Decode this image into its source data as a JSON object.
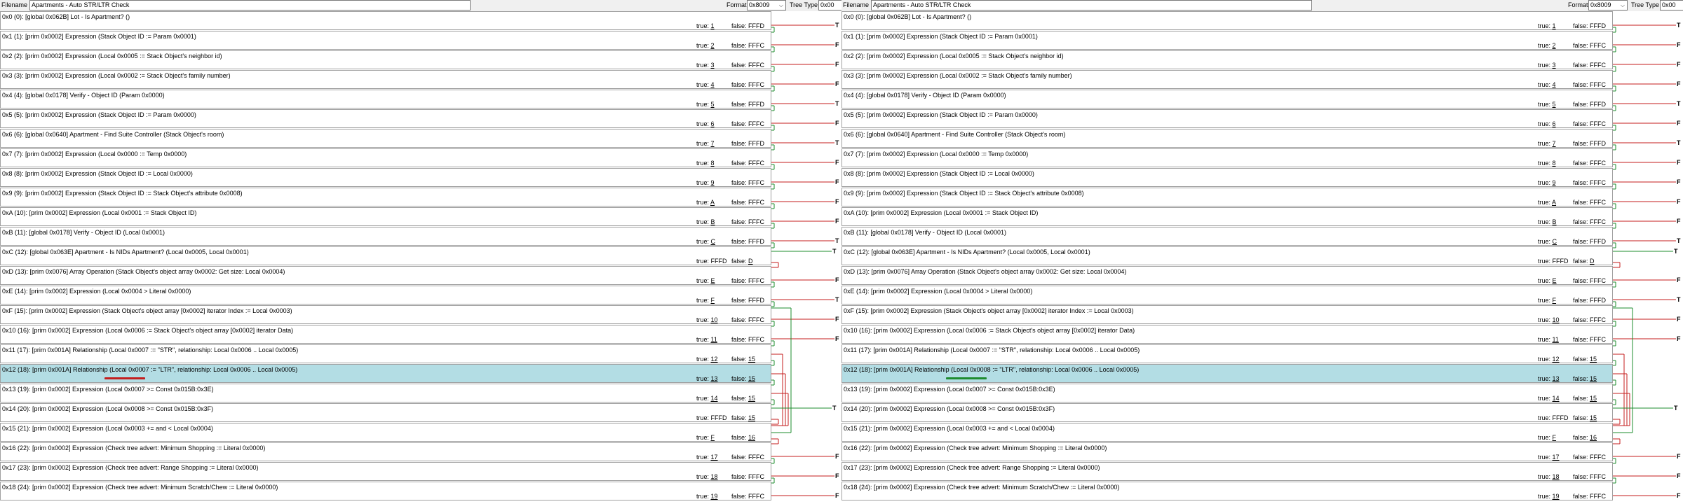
{
  "toolbar": {
    "filename_label": "Filename",
    "filename_value": "Apartments - Auto STR/LTR Check",
    "format_label": "Format",
    "format_value": "0x8009",
    "tree_type_label": "Tree Type",
    "tree_type_value": "0x00"
  },
  "colors": {
    "highlight_row": "#b3dde4",
    "wire_true": "#1e8c2e",
    "wire_false": "#c41e1e",
    "wire_exit": "#000000",
    "marker_left": "#c41e1e",
    "marker_right": "#1e8c2e"
  },
  "left_rows": [
    {
      "text": "0x0 (0): [global 0x062B] Lot - Is Apartment? ()",
      "true_prefix": "true: ",
      "true_target": "1",
      "false_prefix": "false: ",
      "false_target": "FFFD"
    },
    {
      "text": "0x1 (1): [prim 0x0002] Expression (Stack Object ID := Param 0x0001)",
      "true_prefix": "true: ",
      "true_target": "2",
      "false_prefix": "false: ",
      "false_target": "FFFC"
    },
    {
      "text": "0x2 (2): [prim 0x0002] Expression (Local 0x0005 := Stack Object's neighbor id)",
      "true_prefix": "true: ",
      "true_target": "3",
      "false_prefix": "false: ",
      "false_target": "FFFC"
    },
    {
      "text": "0x3 (3): [prim 0x0002] Expression (Local 0x0002 := Stack Object's family number)",
      "true_prefix": "true: ",
      "true_target": "4",
      "false_prefix": "false: ",
      "false_target": "FFFC"
    },
    {
      "text": "0x4 (4): [global 0x0178] Verify - Object ID (Param 0x0000)",
      "true_prefix": "true: ",
      "true_target": "5",
      "false_prefix": "false: ",
      "false_target": "FFFD"
    },
    {
      "text": "0x5 (5): [prim 0x0002] Expression (Stack Object ID := Param 0x0000)",
      "true_prefix": "true: ",
      "true_target": "6",
      "false_prefix": "false: ",
      "false_target": "FFFC"
    },
    {
      "text": "0x6 (6): [global 0x0640] Apartment - Find Suite Controller (Stack Object's room)",
      "true_prefix": "true: ",
      "true_target": "7",
      "false_prefix": "false: ",
      "false_target": "FFFD"
    },
    {
      "text": "0x7 (7): [prim 0x0002] Expression (Local 0x0000 := Temp 0x0000)",
      "true_prefix": "true: ",
      "true_target": "8",
      "false_prefix": "false: ",
      "false_target": "FFFC"
    },
    {
      "text": "0x8 (8): [prim 0x0002] Expression (Stack Object ID := Local 0x0000)",
      "true_prefix": "true: ",
      "true_target": "9",
      "false_prefix": "false: ",
      "false_target": "FFFC"
    },
    {
      "text": "0x9 (9): [prim 0x0002] Expression (Stack Object ID := Stack Object's attribute 0x0008)",
      "true_prefix": "true: ",
      "true_target": "A",
      "false_prefix": "false: ",
      "false_target": "FFFC"
    },
    {
      "text": "0xA (10): [prim 0x0002] Expression (Local 0x0001 := Stack Object ID)",
      "true_prefix": "true: ",
      "true_target": "B",
      "false_prefix": "false: ",
      "false_target": "FFFC"
    },
    {
      "text": "0xB (11): [global 0x0178] Verify - Object ID (Local 0x0001)",
      "true_prefix": "true: ",
      "true_target": "C",
      "false_prefix": "false: ",
      "false_target": "FFFD"
    },
    {
      "text": "0xC (12): [global 0x063E] Apartment - Is NIDs Apartment? (Local 0x0005, Local 0x0001)",
      "true_prefix": "true: ",
      "true_target": "FFFD",
      "false_prefix": "false: ",
      "false_target": "D"
    },
    {
      "text": "0xD (13): [prim 0x0076] Array Operation (Stack Object's object array 0x0002: Get size: Local 0x0004)",
      "true_prefix": "true: ",
      "true_target": "E",
      "false_prefix": "false: ",
      "false_target": "FFFC"
    },
    {
      "text": "0xE (14): [prim 0x0002] Expression (Local 0x0004 > Literal 0x0000)",
      "true_prefix": "true: ",
      "true_target": "F",
      "false_prefix": "false: ",
      "false_target": "FFFD"
    },
    {
      "text": "0xF (15): [prim 0x0002] Expression (Stack Object's object array [0x0002] iterator Index := Local 0x0003)",
      "true_prefix": "true: ",
      "true_target": "10",
      "false_prefix": "false: ",
      "false_target": "FFFC"
    },
    {
      "text": "0x10 (16): [prim 0x0002] Expression (Local 0x0006 := Stack Object's object array [0x0002] iterator Data)",
      "true_prefix": "true: ",
      "true_target": "11",
      "false_prefix": "false: ",
      "false_target": "FFFC"
    },
    {
      "text": "0x11 (17): [prim 0x001A] Relationship (Local 0x0007 := \"STR\", relationship: Local 0x0006 .. Local 0x0005)",
      "true_prefix": "true: ",
      "true_target": "12",
      "false_prefix": "false: ",
      "false_target": "15"
    },
    {
      "text": "0x12 (18): [prim 0x001A] Relationship (Local 0x0007 := \"LTR\", relationship: Local 0x0006 .. Local 0x0005)",
      "true_prefix": "true: ",
      "true_target": "13",
      "false_prefix": "false: ",
      "false_target": "15"
    },
    {
      "text": "0x13 (19): [prim 0x0002] Expression (Local 0x0007 >= Const 0x015B:0x3E)",
      "true_prefix": "true: ",
      "true_target": "14",
      "false_prefix": "false: ",
      "false_target": "15"
    },
    {
      "text": "0x14 (20): [prim 0x0002] Expression (Local 0x0008 >= Const 0x015B:0x3F)",
      "true_prefix": "true: ",
      "true_target": "FFFD",
      "false_prefix": "false: ",
      "false_target": "15"
    },
    {
      "text": "0x15 (21): [prim 0x0002] Expression (Local 0x0003 += and < Local 0x0004)",
      "true_prefix": "true: ",
      "true_target": "F",
      "false_prefix": "false: ",
      "false_target": "16"
    },
    {
      "text": "0x16 (22): [prim 0x0002] Expression (Check tree advert: Minimum Shopping := Literal 0x0000)",
      "true_prefix": "true: ",
      "true_target": "17",
      "false_prefix": "false: ",
      "false_target": "FFFC"
    },
    {
      "text": "0x17 (23): [prim 0x0002] Expression (Check tree advert: Range Shopping := Literal 0x0000)",
      "true_prefix": "true: ",
      "true_target": "18",
      "false_prefix": "false: ",
      "false_target": "FFFC"
    },
    {
      "text": "0x18 (24): [prim 0x0002] Expression (Check tree advert: Minimum Scratch/Chew := Literal 0x0000)",
      "true_prefix": "true: ",
      "true_target": "19",
      "false_prefix": "false: ",
      "false_target": "FFFC"
    }
  ],
  "right_rows": [
    {
      "text": "0x0 (0): [global 0x062B] Lot - Is Apartment? ()",
      "true_prefix": "true: ",
      "true_target": "1",
      "false_prefix": "false: ",
      "false_target": "FFFD"
    },
    {
      "text": "0x1 (1): [prim 0x0002] Expression (Stack Object ID := Param 0x0001)",
      "true_prefix": "true: ",
      "true_target": "2",
      "false_prefix": "false: ",
      "false_target": "FFFC"
    },
    {
      "text": "0x2 (2): [prim 0x0002] Expression (Local 0x0005 := Stack Object's neighbor id)",
      "true_prefix": "true: ",
      "true_target": "3",
      "false_prefix": "false: ",
      "false_target": "FFFC"
    },
    {
      "text": "0x3 (3): [prim 0x0002] Expression (Local 0x0002 := Stack Object's family number)",
      "true_prefix": "true: ",
      "true_target": "4",
      "false_prefix": "false: ",
      "false_target": "FFFC"
    },
    {
      "text": "0x4 (4): [global 0x0178] Verify - Object ID (Param 0x0000)",
      "true_prefix": "true: ",
      "true_target": "5",
      "false_prefix": "false: ",
      "false_target": "FFFD"
    },
    {
      "text": "0x5 (5): [prim 0x0002] Expression (Stack Object ID := Param 0x0000)",
      "true_prefix": "true: ",
      "true_target": "6",
      "false_prefix": "false: ",
      "false_target": "FFFC"
    },
    {
      "text": "0x6 (6): [global 0x0640] Apartment - Find Suite Controller (Stack Object's room)",
      "true_prefix": "true: ",
      "true_target": "7",
      "false_prefix": "false: ",
      "false_target": "FFFD"
    },
    {
      "text": "0x7 (7): [prim 0x0002] Expression (Local 0x0000 := Temp 0x0000)",
      "true_prefix": "true: ",
      "true_target": "8",
      "false_prefix": "false: ",
      "false_target": "FFFC"
    },
    {
      "text": "0x8 (8): [prim 0x0002] Expression (Stack Object ID := Local 0x0000)",
      "true_prefix": "true: ",
      "true_target": "9",
      "false_prefix": "false: ",
      "false_target": "FFFC"
    },
    {
      "text": "0x9 (9): [prim 0x0002] Expression (Stack Object ID := Stack Object's attribute 0x0008)",
      "true_prefix": "true: ",
      "true_target": "A",
      "false_prefix": "false: ",
      "false_target": "FFFC"
    },
    {
      "text": "0xA (10): [prim 0x0002] Expression (Local 0x0001 := Stack Object ID)",
      "true_prefix": "true: ",
      "true_target": "B",
      "false_prefix": "false: ",
      "false_target": "FFFC"
    },
    {
      "text": "0xB (11): [global 0x0178] Verify - Object ID (Local 0x0001)",
      "true_prefix": "true: ",
      "true_target": "C",
      "false_prefix": "false: ",
      "false_target": "FFFD"
    },
    {
      "text": "0xC (12): [global 0x063E] Apartment - Is NIDs Apartment? (Local 0x0005, Local 0x0001)",
      "true_prefix": "true: ",
      "true_target": "FFFD",
      "false_prefix": "false: ",
      "false_target": "D"
    },
    {
      "text": "0xD (13): [prim 0x0076] Array Operation (Stack Object's object array 0x0002: Get size: Local 0x0004)",
      "true_prefix": "true: ",
      "true_target": "E",
      "false_prefix": "false: ",
      "false_target": "FFFC"
    },
    {
      "text": "0xE (14): [prim 0x0002] Expression (Local 0x0004 > Literal 0x0000)",
      "true_prefix": "true: ",
      "true_target": "F",
      "false_prefix": "false: ",
      "false_target": "FFFD"
    },
    {
      "text": "0xF (15): [prim 0x0002] Expression (Stack Object's object array [0x0002] iterator Index := Local 0x0003)",
      "true_prefix": "true: ",
      "true_target": "10",
      "false_prefix": "false: ",
      "false_target": "FFFC"
    },
    {
      "text": "0x10 (16): [prim 0x0002] Expression (Local 0x0006 := Stack Object's object array [0x0002] iterator Data)",
      "true_prefix": "true: ",
      "true_target": "11",
      "false_prefix": "false: ",
      "false_target": "FFFC"
    },
    {
      "text": "0x11 (17): [prim 0x001A] Relationship (Local 0x0007 := \"STR\", relationship: Local 0x0006 .. Local 0x0005)",
      "true_prefix": "true: ",
      "true_target": "12",
      "false_prefix": "false: ",
      "false_target": "15"
    },
    {
      "text": "0x12 (18): [prim 0x001A] Relationship (Local 0x0008 := \"LTR\", relationship: Local 0x0006 .. Local 0x0005)",
      "true_prefix": "true: ",
      "true_target": "13",
      "false_prefix": "false: ",
      "false_target": "15"
    },
    {
      "text": "0x13 (19): [prim 0x0002] Expression (Local 0x0007 >= Const 0x015B:0x3E)",
      "true_prefix": "true: ",
      "true_target": "14",
      "false_prefix": "false: ",
      "false_target": "15"
    },
    {
      "text": "0x14 (20): [prim 0x0002] Expression (Local 0x0008 >= Const 0x015B:0x3F)",
      "true_prefix": "true: ",
      "true_target": "FFFD",
      "false_prefix": "false: ",
      "false_target": "15"
    },
    {
      "text": "0x15 (21): [prim 0x0002] Expression (Local 0x0003 += and < Local 0x0004)",
      "true_prefix": "true: ",
      "true_target": "F",
      "false_prefix": "false: ",
      "false_target": "16"
    },
    {
      "text": "0x16 (22): [prim 0x0002] Expression (Check tree advert: Minimum Shopping := Literal 0x0000)",
      "true_prefix": "true: ",
      "true_target": "17",
      "false_prefix": "false: ",
      "false_target": "FFFC"
    },
    {
      "text": "0x17 (23): [prim 0x0002] Expression (Check tree advert: Range Shopping := Literal 0x0000)",
      "true_prefix": "true: ",
      "true_target": "18",
      "false_prefix": "false: ",
      "false_target": "FFFC"
    },
    {
      "text": "0x18 (24): [prim 0x0002] Expression (Check tree advert: Minimum Scratch/Chew := Literal 0x0000)",
      "true_prefix": "true: ",
      "true_target": "19",
      "false_prefix": "false: ",
      "false_target": "FFFC"
    }
  ],
  "selected_row_index": 18,
  "exit_labels": {
    "FFFD": "T",
    "FFFC": "F"
  }
}
